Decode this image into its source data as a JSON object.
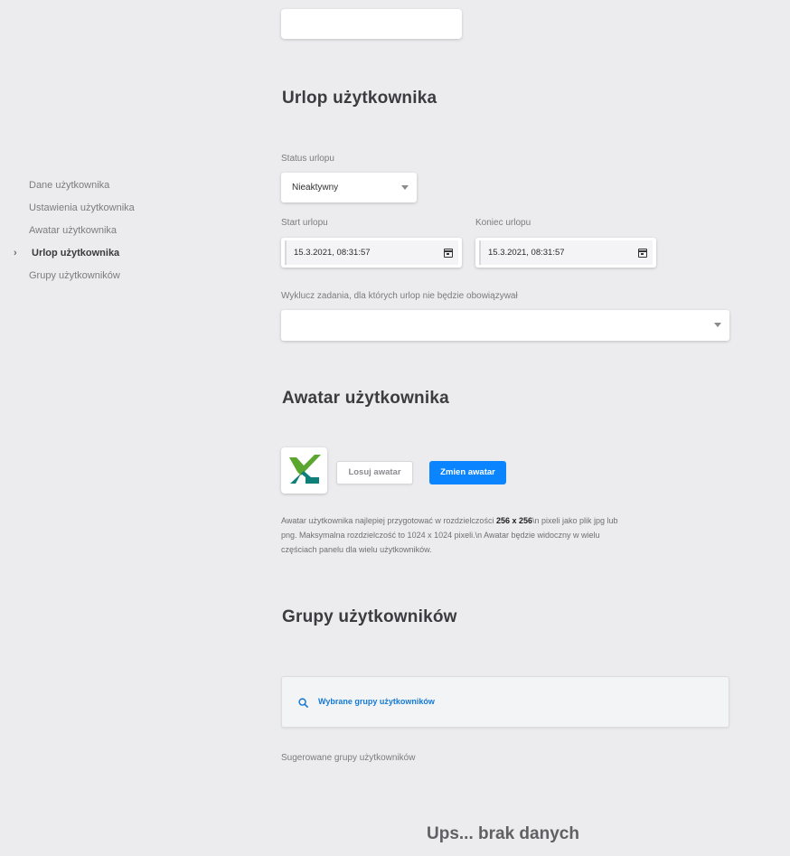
{
  "sidebar": {
    "items": [
      {
        "label": "Dane użytkownika"
      },
      {
        "label": "Ustawienia użytkownika"
      },
      {
        "label": "Awatar użytkownika"
      },
      {
        "label": "Urlop użytkownika",
        "active": true
      },
      {
        "label": "Grupy użytkowników"
      }
    ],
    "active_indicator": "›"
  },
  "vacation": {
    "title": "Urlop użytkownika",
    "status_label": "Status urlopu",
    "status_value": "Nieaktywny",
    "start_label": "Start urlopu",
    "start_value": "15.3.2021, 08:31:57",
    "end_label": "Koniec urlopu",
    "end_value": "15.3.2021, 08:31:57",
    "exclude_label": "Wyklucz zadania, dla których urlop nie będzie obowiązywał",
    "exclude_value": ""
  },
  "avatar": {
    "title": "Awatar użytkownika",
    "random_button": "Losuj awatar",
    "change_button": "Zmien awatar",
    "desc_part1": "Awatar użytkownika najlepiej przygotować w rozdzielczości ",
    "desc_bold": "256 x 256",
    "desc_part2": "\\n pixeli jako plik jpg lub png. Maksymalna rozdzielczość to 1024 x 1024 pixeli.\\n Awatar będzie widoczny w wielu częściach panelu dla wielu użytkowników.",
    "logo_colors": {
      "green": "#5aa62f",
      "teal": "#0f7f7a"
    }
  },
  "groups": {
    "title": "Grupy użytkowników",
    "selected_label": "Wybrane grupy użytkowników",
    "suggested_label": "Sugerowane grupy użytkowników",
    "empty_text": "Ups... brak danych"
  },
  "colors": {
    "accent": "#0a84ff",
    "link": "#1479d6",
    "background": "#ececee"
  }
}
